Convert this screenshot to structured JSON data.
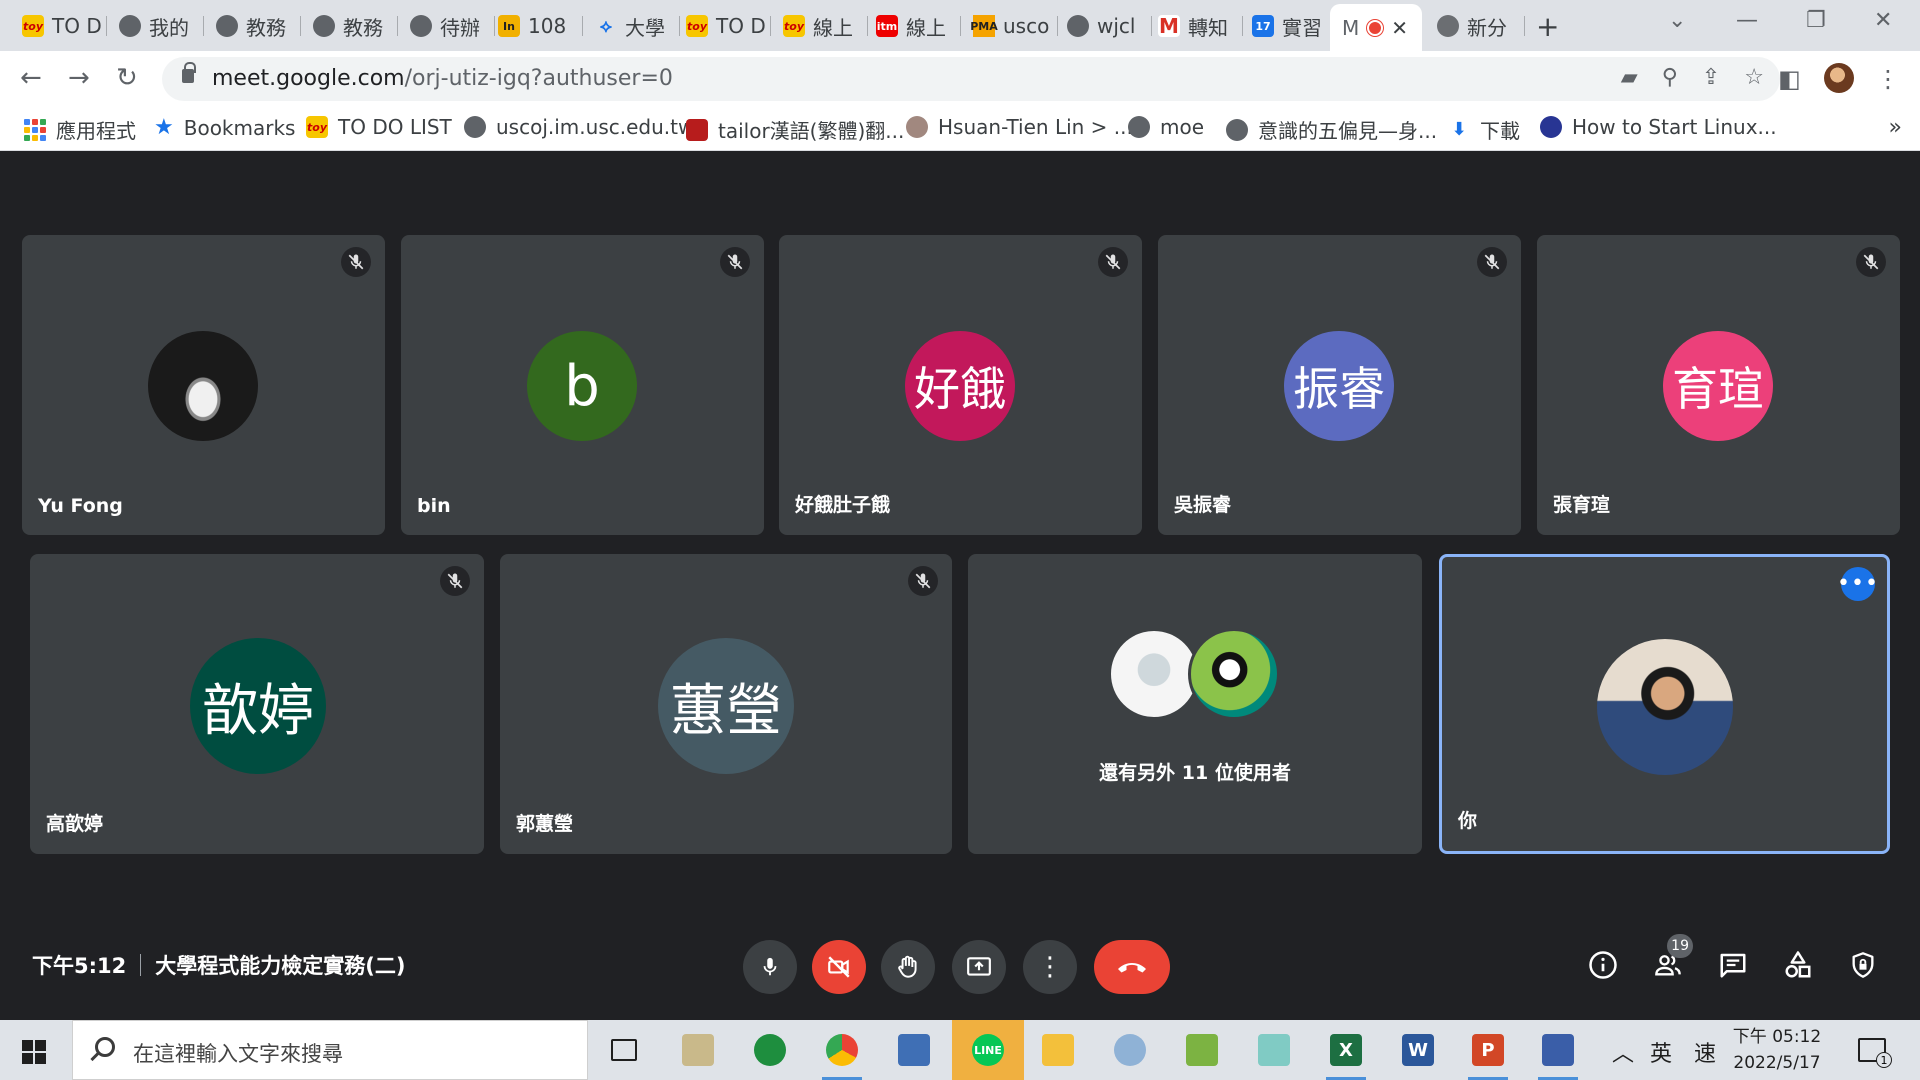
{
  "browser": {
    "tabs": [
      {
        "label": "TO D",
        "favicon": "toy-icon"
      },
      {
        "label": "我的",
        "favicon": "globe-icon"
      },
      {
        "label": "教務",
        "favicon": "globe-icon"
      },
      {
        "label": "教務",
        "favicon": "globe-icon"
      },
      {
        "label": "待辦",
        "favicon": "globe-icon"
      },
      {
        "label": "108",
        "favicon": "yellow-book-icon"
      },
      {
        "label": "大學",
        "favicon": "ai-icon"
      },
      {
        "label": "TO D",
        "favicon": "toy-icon"
      },
      {
        "label": "線上",
        "favicon": "toy-icon"
      },
      {
        "label": "線上",
        "favicon": "itm-icon"
      },
      {
        "label": "usco",
        "favicon": "pma-icon"
      },
      {
        "label": "wjcl",
        "favicon": "globe-icon"
      },
      {
        "label": "轉知",
        "favicon": "gmail-icon"
      },
      {
        "label": "實習",
        "favicon": "calendar-icon"
      },
      {
        "label": "M",
        "favicon": "meet-icon",
        "active": true
      },
      {
        "label": "新分",
        "favicon": "chrome-icon"
      }
    ],
    "url_host": "meet.google.com",
    "url_path": "/orj-utiz-igq?authuser=0",
    "bookmarks": [
      {
        "label": "應用程式",
        "icon": "apps-grid-icon"
      },
      {
        "label": "Bookmarks",
        "icon": "star-icon"
      },
      {
        "label": "TO DO LIST",
        "icon": "toy-icon"
      },
      {
        "label": "uscoj.im.usc.edu.tw",
        "icon": "globe-icon"
      },
      {
        "label": "tailor漢語(繁體)翻...",
        "icon": "crest-icon"
      },
      {
        "label": "Hsuan-Tien Lin > ...",
        "icon": "avatar-icon"
      },
      {
        "label": "moe",
        "icon": "globe-icon"
      },
      {
        "label": "意識的五偏見—身...",
        "icon": "globe-icon"
      },
      {
        "label": "下載",
        "icon": "download-icon"
      },
      {
        "label": "How to Start Linux...",
        "icon": "shield-icon"
      }
    ]
  },
  "meet": {
    "participants": [
      {
        "name": "Yu Fong",
        "initials": "",
        "color": "#202124",
        "photo": "car-photo",
        "muted": true
      },
      {
        "name": "bin",
        "initials": "b",
        "color": "#33691e",
        "muted": true
      },
      {
        "name": "好餓肚子餓",
        "initials": "好餓",
        "color": "#c2185b",
        "muted": true
      },
      {
        "name": "吳振睿",
        "initials": "振睿",
        "color": "#5c6bc0",
        "muted": true
      },
      {
        "name": "張育瑄",
        "initials": "育瑄",
        "color": "#ec407a",
        "muted": true
      },
      {
        "name": "高歆婷",
        "initials": "歆婷",
        "color": "#004d40",
        "muted": true
      },
      {
        "name": "郭蕙瑩",
        "initials": "蕙瑩",
        "color": "#455a64",
        "muted": true
      }
    ],
    "others_text": "還有另外 11 位使用者",
    "self_name": "你",
    "time": "下午5:12",
    "meeting_title": "大學程式能力檢定實務(二)",
    "people_count": "19"
  },
  "taskbar": {
    "search_placeholder": "在這裡輸入文字來搜尋",
    "ime_lang": "英",
    "ime_mode": "速",
    "clock_time": "下午 05:12",
    "clock_date": "2022/5/17",
    "notification_count": "1"
  }
}
